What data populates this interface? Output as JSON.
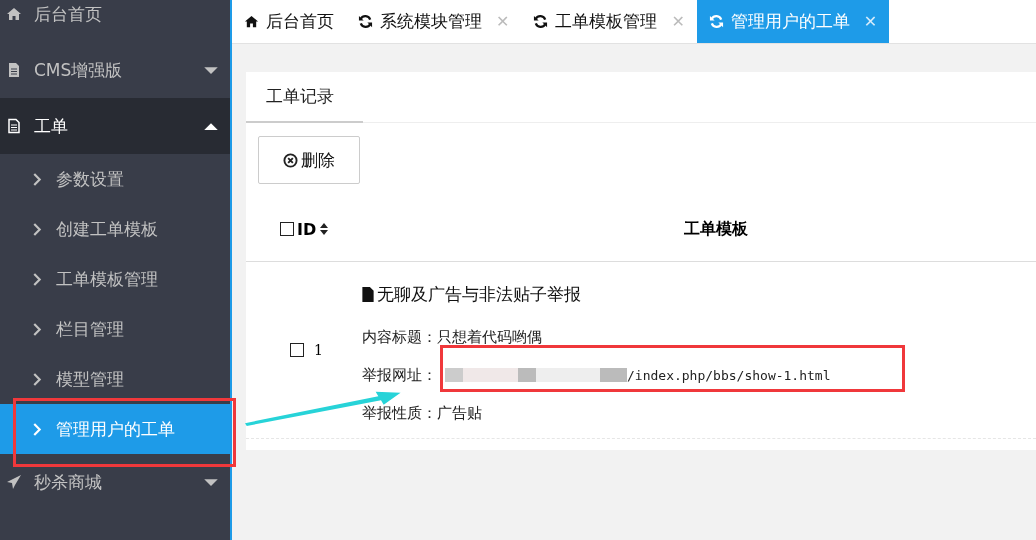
{
  "sidebar": {
    "items": [
      {
        "label": "后台首页",
        "expanded": false,
        "has_caret": false
      },
      {
        "label": "CMS增强版",
        "expanded": false,
        "has_caret": true
      },
      {
        "label": "工单",
        "expanded": true,
        "has_caret": true,
        "children": [
          {
            "label": "参数设置",
            "selected": false
          },
          {
            "label": "创建工单模板",
            "selected": false
          },
          {
            "label": "工单模板管理",
            "selected": false
          },
          {
            "label": "栏目管理",
            "selected": false
          },
          {
            "label": "模型管理",
            "selected": false
          },
          {
            "label": "管理用户的工单",
            "selected": true
          }
        ]
      },
      {
        "label": "秒杀商城",
        "expanded": false,
        "has_caret": true
      }
    ]
  },
  "tabs": [
    {
      "label": "后台首页",
      "closable": false,
      "selected": false
    },
    {
      "label": "系统模块管理",
      "closable": true,
      "selected": false
    },
    {
      "label": "工单模板管理",
      "closable": true,
      "selected": false
    },
    {
      "label": "管理用户的工单",
      "closable": true,
      "selected": true
    }
  ],
  "close_glyph": "✕",
  "panel": {
    "tab": "工单记录",
    "delete_button": "删除",
    "table": {
      "columns": [
        "ID",
        "工单模板"
      ],
      "all_checked": false,
      "rows": [
        {
          "checked": false,
          "id": "1",
          "title": "无聊及广告与非法贴子举报",
          "fields": [
            {
              "label": "内容标题：",
              "value": "只想着代码哟偶",
              "blurred": false
            },
            {
              "label": "举报网址：",
              "value": "/index.php/bbs/show-1.html",
              "blurred": true
            },
            {
              "label": "举报性质：",
              "value": "广告贴",
              "blurred": false
            }
          ]
        }
      ]
    }
  }
}
